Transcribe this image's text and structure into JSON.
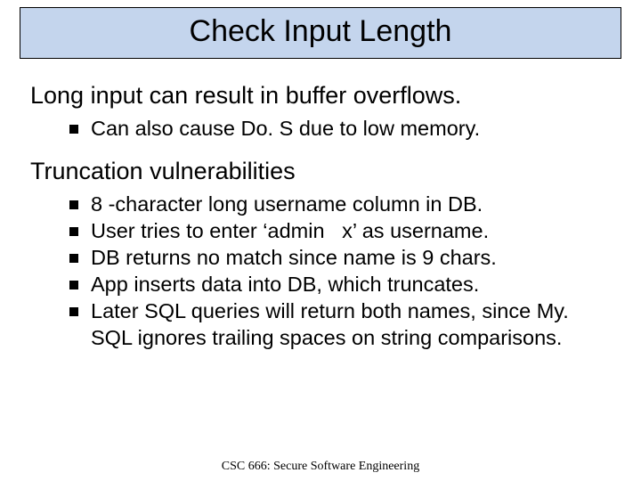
{
  "title": "Check Input Length",
  "section1": {
    "heading": "Long input can result in buffer overflows.",
    "items": [
      "Can also cause Do. S due to low memory."
    ]
  },
  "section2": {
    "heading": "Truncation vulnerabilities",
    "items": [
      "8 -character long username column in DB.",
      "User tries to enter ‘admin   x’ as username.",
      "DB returns no match since name is 9 chars.",
      "App inserts data into DB, which truncates.",
      "Later SQL queries will return both names, since My. SQL ignores trailing spaces on string comparisons."
    ]
  },
  "footer": "CSC 666: Secure Software Engineering"
}
